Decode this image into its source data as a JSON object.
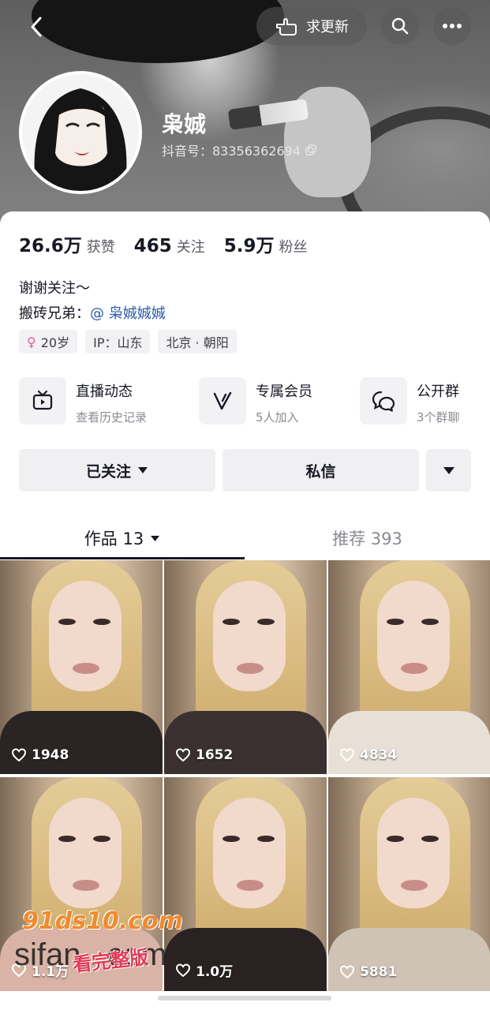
{
  "nav": {
    "update_label": "求更新"
  },
  "profile": {
    "name": "枭娍",
    "id_label": "抖音号：83356362694"
  },
  "stats": [
    {
      "num": "26.6万",
      "label": "获赞"
    },
    {
      "num": "465",
      "label": "关注"
    },
    {
      "num": "5.9万",
      "label": "粉丝"
    }
  ],
  "bio": {
    "line1": "谢谢关注～",
    "line2_prefix": "搬砖兄弟：",
    "line2_mention": "@ 枭娍娍娍"
  },
  "tags": {
    "age": "20岁",
    "ip": "IP：山东",
    "location": "北京 · 朝阳"
  },
  "features": [
    {
      "title": "直播动态",
      "sub": "查看历史记录",
      "icon": "tv-icon"
    },
    {
      "title": "专属会员",
      "sub": "5人加入",
      "icon": "v-badge-icon"
    },
    {
      "title": "公开群",
      "sub": "3个群聊",
      "icon": "chat-group-icon"
    }
  ],
  "actions": {
    "follow_label": "已关注",
    "message_label": "私信"
  },
  "tabs": {
    "works_label": "作品 13",
    "recommend_label": "推荐 393"
  },
  "videos": [
    {
      "likes": "1948"
    },
    {
      "likes": "1652"
    },
    {
      "likes": "4834"
    },
    {
      "likes": "1.1万"
    },
    {
      "likes": "1.0万"
    },
    {
      "likes": "5881"
    }
  ],
  "watermarks": {
    "site1": "91ds10.com",
    "site2": "sifan...com",
    "badge": "看完整版"
  },
  "colors": {
    "accent_mention": "#2d5aa6",
    "female_icon": "#e85a9c",
    "button_bg": "#f0f0f2"
  }
}
